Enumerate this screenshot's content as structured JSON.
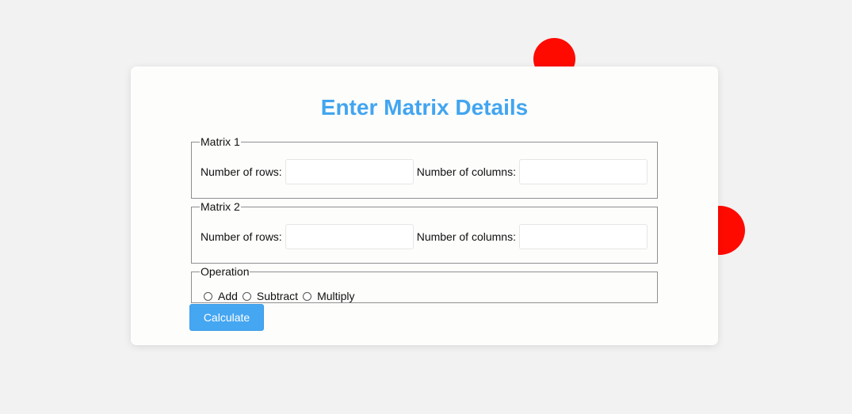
{
  "page": {
    "title": "Enter Matrix Details"
  },
  "matrix1": {
    "legend": "Matrix 1",
    "rows_label": "Number of rows:",
    "rows_value": "",
    "cols_label": "Number of columns:",
    "cols_value": ""
  },
  "matrix2": {
    "legend": "Matrix 2",
    "rows_label": "Number of rows:",
    "rows_value": "",
    "cols_label": "Number of columns:",
    "cols_value": ""
  },
  "operation": {
    "legend": "Operation",
    "options": [
      {
        "label": "Add",
        "selected": false
      },
      {
        "label": "Subtract",
        "selected": false
      },
      {
        "label": "Multiply",
        "selected": false
      }
    ]
  },
  "calculate_button": {
    "label": "Calculate"
  },
  "colors": {
    "background": "#f2f2f2",
    "card": "#fdfdfc",
    "title": "#42a5f0",
    "button": "#45a6f2",
    "decor_blob": "#ff0a00"
  }
}
